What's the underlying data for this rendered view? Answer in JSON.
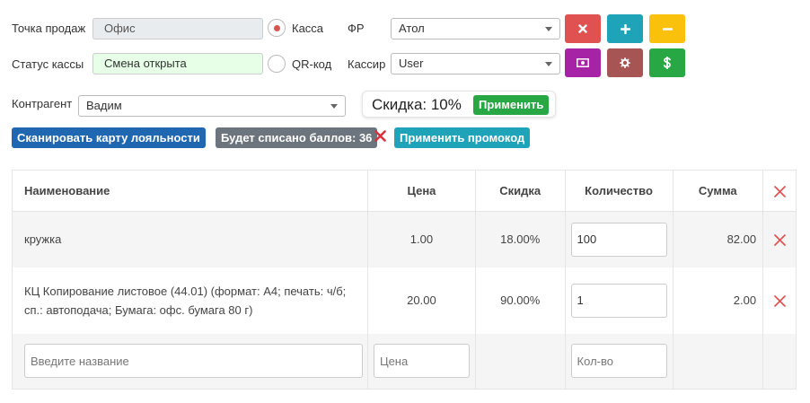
{
  "top": {
    "sale_point_label": "Точка продаж",
    "sale_point_value": "Офис",
    "register_status_label": "Статус кассы",
    "register_status_value": "Смена открыта",
    "radio_cash_label": "Касса",
    "radio_qr_label": "QR-код",
    "fr_label": "ФР",
    "fr_value": "Атол",
    "cashier_label": "Кассир",
    "cashier_value": "User",
    "counterparty_label": "Контрагент",
    "counterparty_value": "Вадим"
  },
  "buttons": {
    "red_icon": "times-icon",
    "teal_icon": "plus-icon",
    "yellow_icon": "minus-icon",
    "purple_icon": "money-icon",
    "brown_icon": "gear-icon",
    "green_icon": "dollar-icon"
  },
  "discount": {
    "text": "Скидка: 10%",
    "apply_label": "Применить"
  },
  "actions": {
    "scan_card": "Сканировать карту лояльности",
    "points_badge": "Будет списано баллов: 36",
    "apply_promo": "Применить промокод"
  },
  "table": {
    "headers": [
      "Наименование",
      "Цена",
      "Скидка",
      "Количество",
      "Сумма"
    ],
    "rows": [
      {
        "name": "кружка",
        "price": "1.00",
        "discount": "18.00%",
        "qty": "100",
        "sum": "82.00"
      },
      {
        "name": "КЦ Копирование листовое (44.01) (формат: А4; печать: ч/б; сп.: автоподача; Бумага: офс. бумага 80 г)",
        "price": "20.00",
        "discount": "90.00%",
        "qty": "1",
        "sum": "2.00"
      }
    ],
    "new_row": {
      "name_placeholder": "Введите название",
      "price_placeholder": "Цена",
      "qty_placeholder": "Кол-во"
    }
  },
  "colors": {
    "red": "#e05252",
    "teal": "#1fa3b8",
    "yellow": "#f9c00c",
    "purple": "#a623a6",
    "brown": "#a65454",
    "green": "#28a745",
    "blue": "#2067b1",
    "grey": "#6c757d"
  }
}
